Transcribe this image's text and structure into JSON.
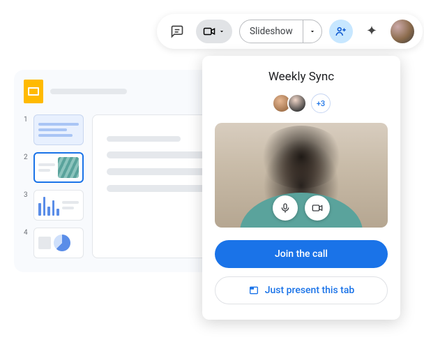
{
  "toolbar": {
    "slideshow_label": "Slideshow"
  },
  "slides": {
    "thumbs": [
      "1",
      "2",
      "3",
      "4"
    ]
  },
  "meet": {
    "title": "Weekly Sync",
    "more_count": "+3",
    "join_label": "Join the call",
    "present_label": "Just present this tab"
  }
}
